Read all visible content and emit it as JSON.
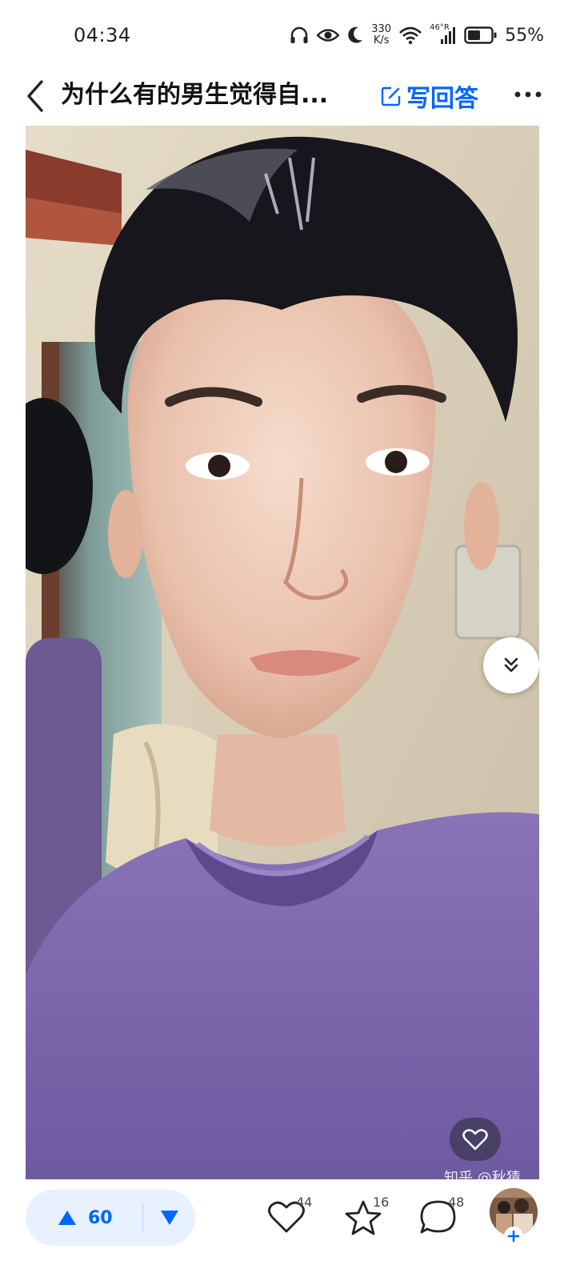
{
  "status_bar": {
    "time": "04:34",
    "net_speed_value": "330",
    "net_speed_unit": "K/s",
    "network_type": "46°R",
    "battery": "55%",
    "icons": [
      "headphones-icon",
      "eye-icon",
      "moon-icon",
      "wifi-icon",
      "signal-icon",
      "battery-icon"
    ]
  },
  "header": {
    "title": "为什么有的男生觉得自...",
    "write_answer_label": "写回答"
  },
  "photo": {
    "watermark": "知乎 @秋猜"
  },
  "bottom_bar": {
    "upvote_count": "60",
    "like_count": "44",
    "favorite_count": "16",
    "comment_count": "48"
  },
  "colors": {
    "accent": "#0066ff",
    "vote_bg": "#e8f1ff",
    "shirt": "#7a64a8"
  }
}
